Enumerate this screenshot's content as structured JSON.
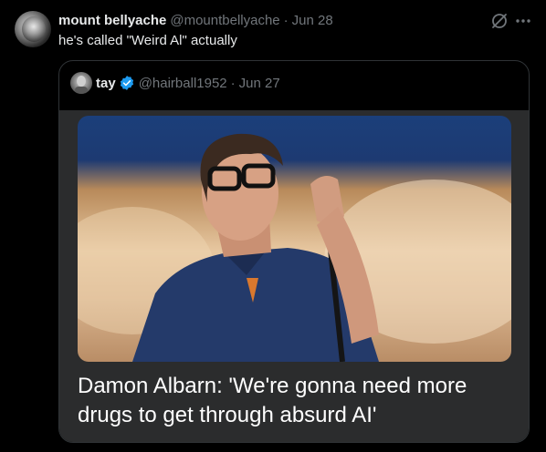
{
  "tweet": {
    "display_name": "mount bellyache",
    "handle": "@mountbellyache",
    "separator": "·",
    "date": "Jun 28",
    "text": "he's called \"Weird Al\" actually",
    "avatar_icon": "avatar-icon",
    "actions": {
      "grok_icon": "grok-icon",
      "more_icon": "more-icon"
    }
  },
  "quote": {
    "display_name": "tay",
    "verified_icon": "verified-badge-icon",
    "verified_color": "#1d9bf0",
    "handle": "@hairball1952",
    "separator": "·",
    "date": "Jun 27",
    "card": {
      "headline": "Damon Albarn: 'We're gonna need more drugs to get through absurd AI'"
    }
  },
  "colors": {
    "background": "#000000",
    "text_primary": "#e7e9ea",
    "text_secondary": "#71767b",
    "border": "#2f3336",
    "card_bg": "#2b2c2d"
  }
}
